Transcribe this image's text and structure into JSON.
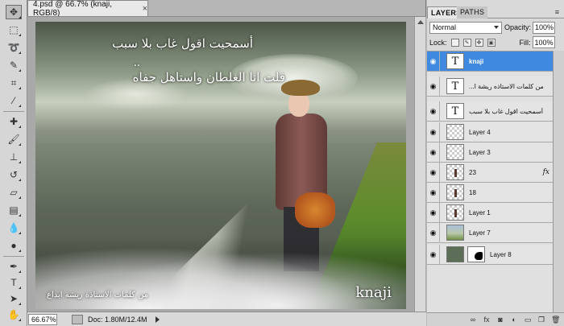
{
  "document": {
    "tab_title": "4.psd @ 66.7% (knaji, RGB/8)",
    "close_glyph": "×"
  },
  "image_text": {
    "line1": "أسمحيت اقول غاب بلا سبب",
    "dots": "..",
    "line2": "قلت انا الغلطان واستاهل جفاه",
    "credit": "من كلمات الاستاذة ريشة ابداع",
    "signature": "knaji"
  },
  "statusbar": {
    "zoom": "66.67%",
    "doc_info": "Doc: 1.80M/12.4M"
  },
  "panel": {
    "tabs": [
      "LAYERS",
      "PATHS"
    ],
    "menu_glyph": "≡",
    "blend_mode": "Normal",
    "opacity_label": "Opacity:",
    "opacity_value": "100%",
    "lock_label": "Lock:",
    "fill_label": "Fill:",
    "fill_value": "100%",
    "layers": [
      {
        "name": "knaji",
        "thumb": "T",
        "selected": true
      },
      {
        "name": "من كلمات الاستاذه ريشة ا...",
        "thumb": "T",
        "selected": false
      },
      {
        "name": "أسمحيت اقول غاب بلا سبب",
        "thumb": "T",
        "selected": false
      },
      {
        "name": "Layer 4",
        "thumb": "",
        "selected": false
      },
      {
        "name": "Layer 3",
        "thumb": "",
        "selected": false
      },
      {
        "name": "23",
        "thumb": "",
        "selected": false,
        "fx": "fx"
      },
      {
        "name": "18",
        "thumb": "",
        "selected": false
      },
      {
        "name": "Layer 1",
        "thumb": "",
        "selected": false
      },
      {
        "name": "Layer 7",
        "thumb": "",
        "selected": false
      },
      {
        "name": "Layer 8",
        "thumb": "",
        "selected": false
      }
    ]
  },
  "colors": {
    "selected_layer": "#3f8ae0",
    "panel_bg": "#d9d9d9"
  }
}
